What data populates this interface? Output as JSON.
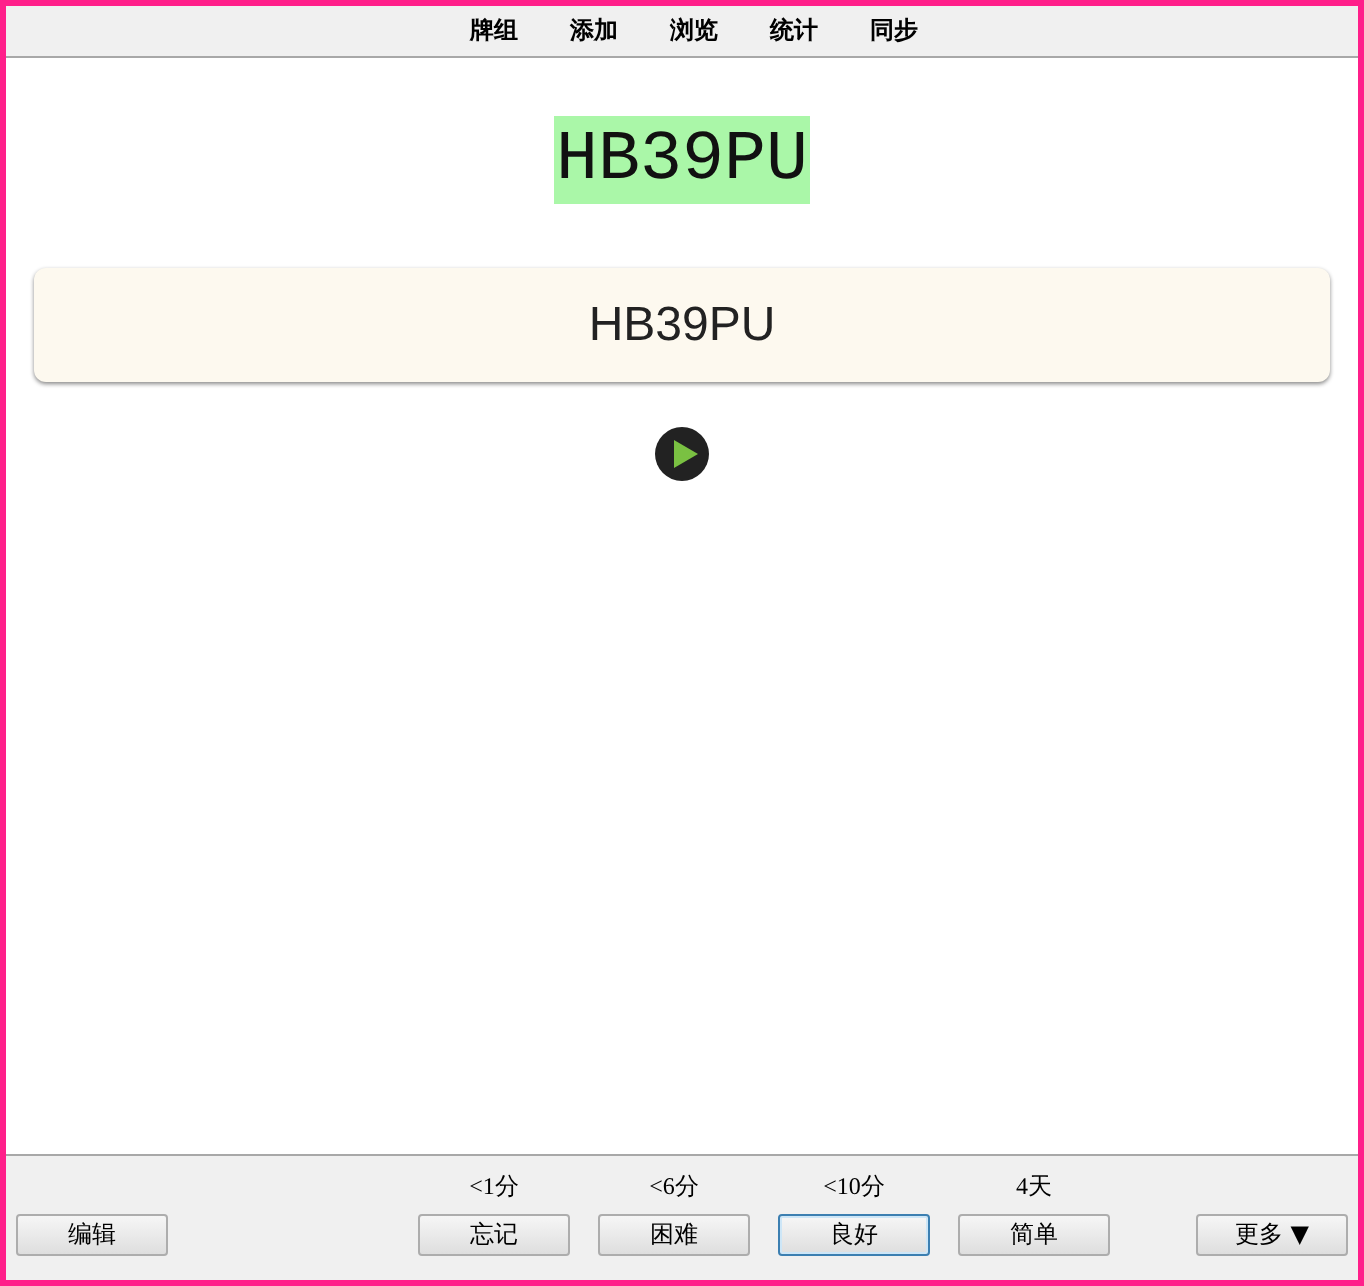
{
  "nav": [
    {
      "label": "牌组"
    },
    {
      "label": "添加"
    },
    {
      "label": "浏览"
    },
    {
      "label": "统计"
    },
    {
      "label": "同步"
    }
  ],
  "card": {
    "question": "HB39PU",
    "answer": "HB39PU"
  },
  "bottom_bar": {
    "edit_button": "编辑",
    "answers": [
      {
        "interval": "<1分",
        "label": "忘记",
        "focused": false
      },
      {
        "interval": "<6分",
        "label": "困难",
        "focused": false
      },
      {
        "interval": "<10分",
        "label": "良好",
        "focused": true
      },
      {
        "interval": "4天",
        "label": "简单",
        "focused": false
      }
    ],
    "more_button": "更多 ▼"
  }
}
